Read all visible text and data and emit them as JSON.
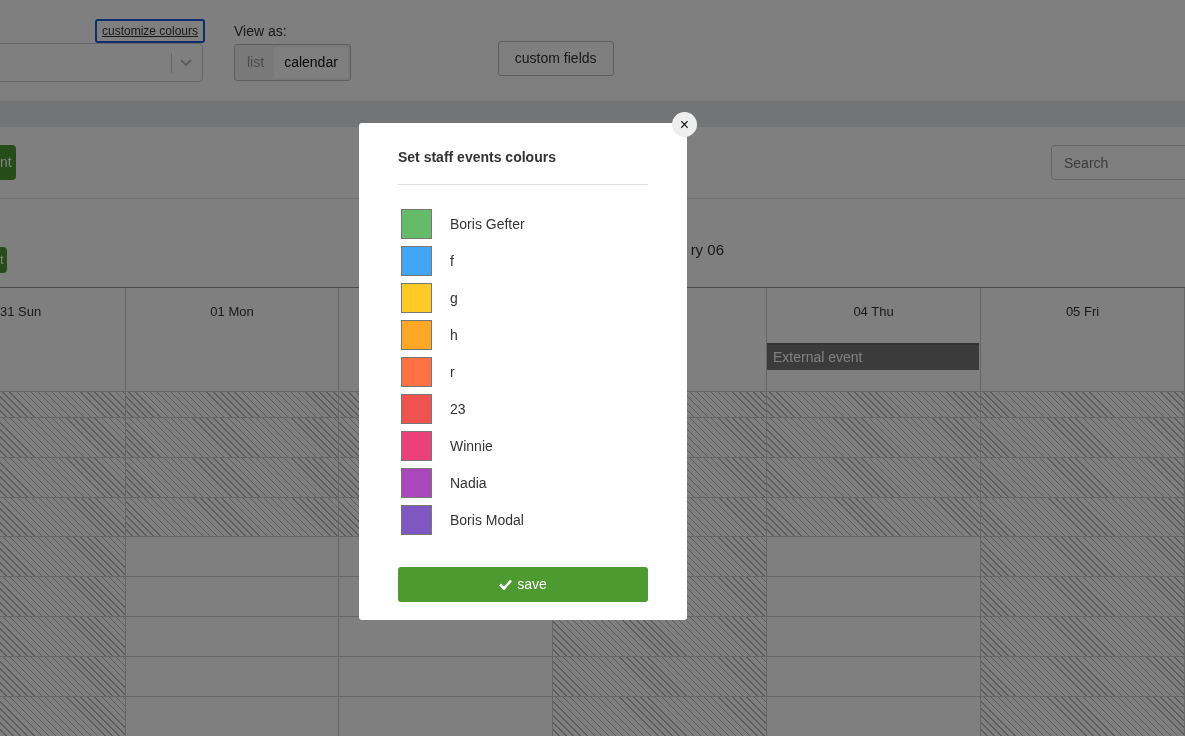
{
  "top_bar": {
    "customize_link": "customize colours",
    "view_as_label": "View as:",
    "view_options": [
      {
        "label": "list",
        "selected": false
      },
      {
        "label": "calendar",
        "selected": true
      }
    ],
    "custom_fields_button": "custom fields"
  },
  "toolbar": {
    "add_button": "nt",
    "search": {
      "placeholder": "Search"
    }
  },
  "period": {
    "button": "t",
    "title": "ry 06"
  },
  "days": [
    {
      "header": "31 Sun",
      "closed": true
    },
    {
      "header": "01 Mon",
      "closed": false
    },
    {
      "closed": false
    },
    {
      "closed": true
    },
    {
      "header": "04 Thu",
      "closed": false,
      "events": [
        "External event"
      ]
    },
    {
      "header": "05 Fri",
      "closed": true
    }
  ],
  "modal": {
    "title": "Set staff events colours",
    "close": "×",
    "staff": [
      {
        "name": "Boris Gefter",
        "color": "#66bb6a"
      },
      {
        "name": "f",
        "color": "#42a5f5"
      },
      {
        "name": "g",
        "color": "#ffca28"
      },
      {
        "name": "h",
        "color": "#ffa726"
      },
      {
        "name": "r",
        "color": "#ff7043"
      },
      {
        "name": "23",
        "color": "#ef5350"
      },
      {
        "name": "Winnie",
        "color": "#ec407a"
      },
      {
        "name": "Nadia",
        "color": "#ab47bc"
      },
      {
        "name": "Boris Modal",
        "color": "#7e57c2"
      }
    ],
    "save_button": "save"
  }
}
